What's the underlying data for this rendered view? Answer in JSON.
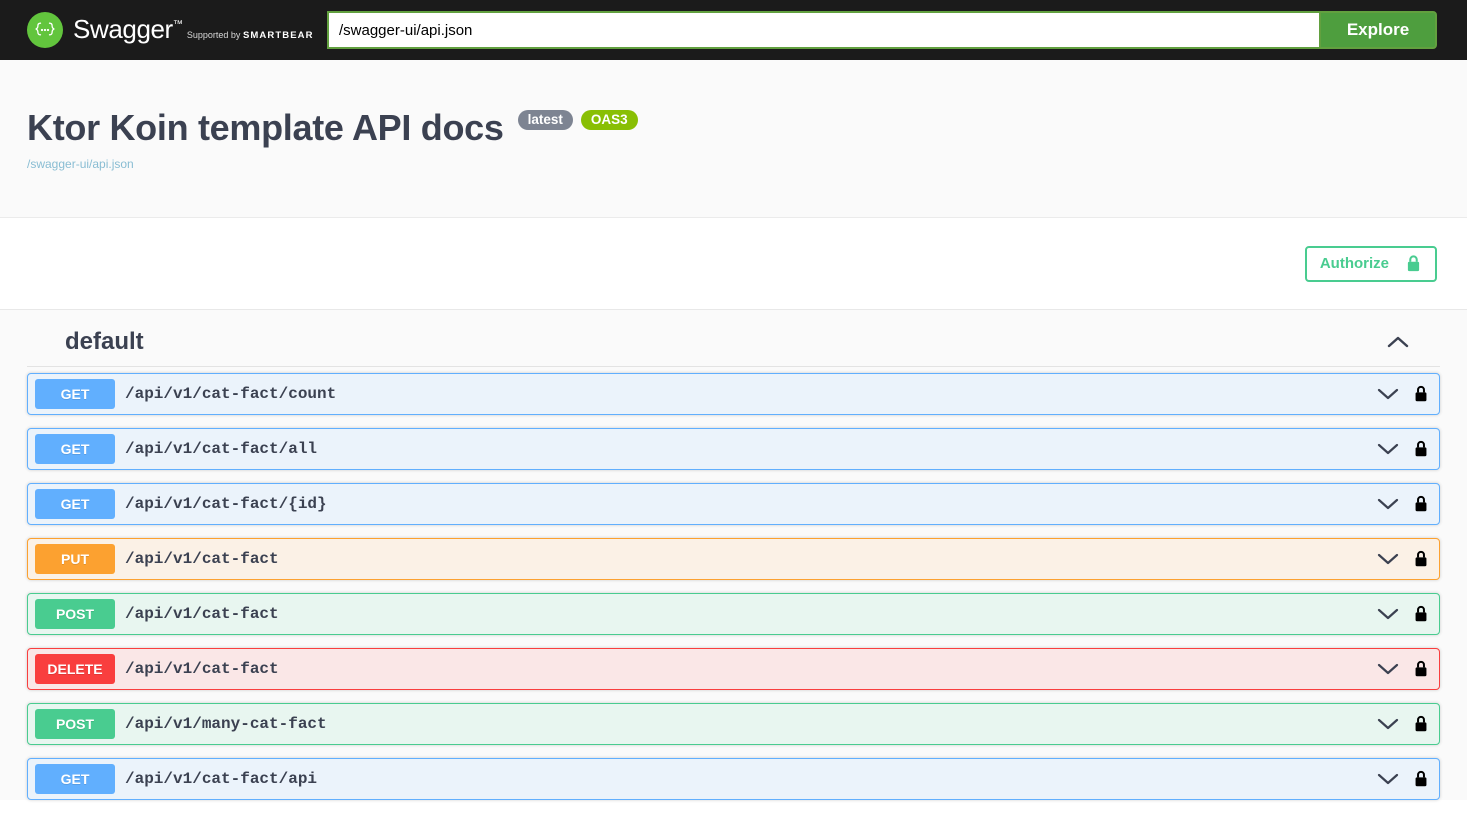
{
  "topbar": {
    "logo_title": "Swagger",
    "logo_trademark": "™",
    "logo_supported_by": "Supported by",
    "logo_brand": "SMARTBEAR",
    "url_value": "/swagger-ui/api.json",
    "url_placeholder": "",
    "explore_label": "Explore"
  },
  "info": {
    "title": "Ktor Koin template API docs",
    "version_badge": "latest",
    "spec_badge": "OAS3",
    "url_link": "/swagger-ui/api.json"
  },
  "authorize": {
    "label": "Authorize",
    "icon": "lock-icon"
  },
  "tag": {
    "name": "default",
    "collapse_icon": "chevron-up-icon"
  },
  "operations": [
    {
      "method": "GET",
      "path": "/api/v1/cat-fact/count",
      "style": "get",
      "expand_icon": "chevron-down-icon",
      "auth_icon": "lock-icon"
    },
    {
      "method": "GET",
      "path": "/api/v1/cat-fact/all",
      "style": "get",
      "expand_icon": "chevron-down-icon",
      "auth_icon": "lock-icon"
    },
    {
      "method": "GET",
      "path": "/api/v1/cat-fact/{id}",
      "style": "get",
      "expand_icon": "chevron-down-icon",
      "auth_icon": "lock-icon"
    },
    {
      "method": "PUT",
      "path": "/api/v1/cat-fact",
      "style": "put",
      "expand_icon": "chevron-down-icon",
      "auth_icon": "lock-icon"
    },
    {
      "method": "POST",
      "path": "/api/v1/cat-fact",
      "style": "post",
      "expand_icon": "chevron-down-icon",
      "auth_icon": "lock-icon"
    },
    {
      "method": "DELETE",
      "path": "/api/v1/cat-fact",
      "style": "delete",
      "expand_icon": "chevron-down-icon",
      "auth_icon": "lock-icon"
    },
    {
      "method": "POST",
      "path": "/api/v1/many-cat-fact",
      "style": "post",
      "expand_icon": "chevron-down-icon",
      "auth_icon": "lock-icon"
    },
    {
      "method": "GET",
      "path": "/api/v1/cat-fact/api",
      "style": "get",
      "expand_icon": "chevron-down-icon",
      "auth_icon": "lock-icon"
    }
  ],
  "colors": {
    "get": "#61affe",
    "post": "#49cc90",
    "put": "#fca130",
    "delete": "#f93e3e",
    "brand_green": "#62c53d",
    "explore_green": "#4e9e3e",
    "authorize_green": "#49cc90",
    "oas_green": "#89bf04",
    "version_gray": "#7d8492",
    "text_dark": "#3b4151",
    "topbar_bg": "#1b1b1b"
  }
}
